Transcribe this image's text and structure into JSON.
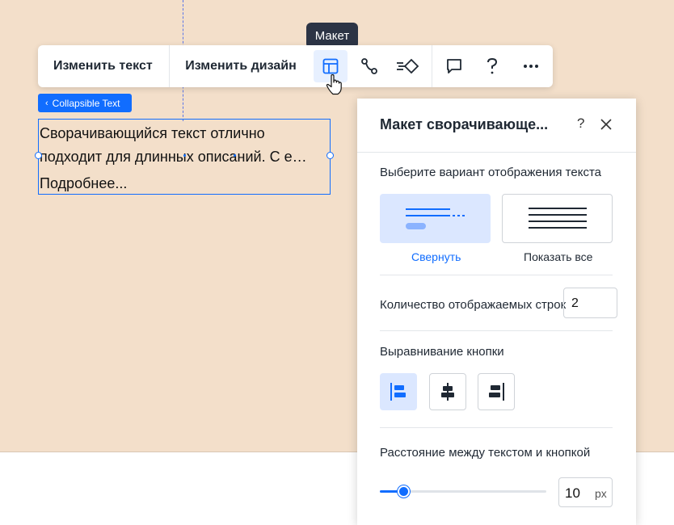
{
  "tooltip": {
    "text": "Макет"
  },
  "toolbar": {
    "edit_text": "Изменить текст",
    "edit_design": "Изменить дизайн",
    "icons": [
      "layout-icon",
      "animation-path-icon",
      "interactions-icon",
      "comment-icon",
      "help-icon",
      "more-icon"
    ]
  },
  "component_tag": {
    "label": "Collapsible Text"
  },
  "text_box": {
    "lines": [
      "Сворачивающийся текст отлично",
      "подходит для длинных описаний. С е…"
    ],
    "more_link": "Подробнее..."
  },
  "panel": {
    "title": "Макет сворачивающе...",
    "help": "?",
    "display_section": {
      "label": "Выберите вариант отображения текста",
      "options": [
        {
          "label": "Свернуть",
          "selected": true
        },
        {
          "label": "Показать все",
          "selected": false
        }
      ]
    },
    "lines_count": {
      "label": "Количество отображаемых строк",
      "value": "2"
    },
    "button_alignment": {
      "label": "Выравнивание кнопки",
      "options": [
        "align-left",
        "align-center",
        "align-right"
      ],
      "selected": "align-left"
    },
    "spacing": {
      "label": "Расстояние между текстом и кнопкой",
      "value": "10",
      "unit": "px",
      "slider_fraction": 0.14
    }
  },
  "colors": {
    "accent": "#116dff",
    "canvas": "#f3dfca",
    "selected_bg": "#dbe7ff",
    "tooltip_bg": "#2c3445"
  }
}
